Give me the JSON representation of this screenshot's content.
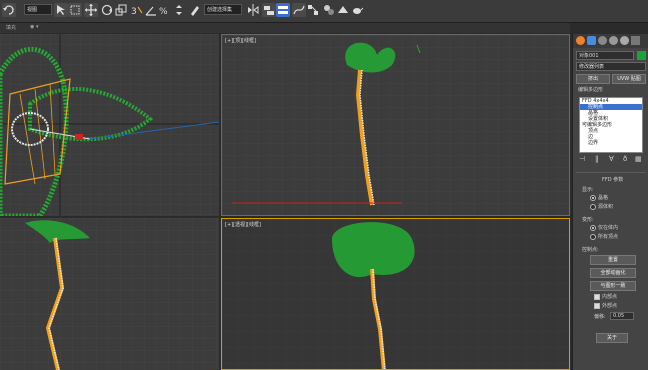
{
  "toolbar": {
    "select_filter": "视图",
    "selection_set": "创建选择集",
    "icons": [
      "undo-icon",
      "redo-icon",
      "select-icon",
      "select-region-icon",
      "move-icon",
      "rotate-icon",
      "scale-icon",
      "snap-icon",
      "angle-snap-icon",
      "percent-snap-icon",
      "spinner-snap-icon",
      "named-selection-icon",
      "mirror-icon",
      "align-icon",
      "layer-icon",
      "curve-editor-icon",
      "schematic-icon",
      "material-editor-icon",
      "render-setup-icon",
      "render-frame-icon",
      "render-icon",
      "teapot-icon"
    ]
  },
  "subbar": {
    "label": "填充"
  },
  "viewports": [
    {
      "id": "top-left",
      "label": ""
    },
    {
      "id": "top-right",
      "label": "[+][顶][线框]"
    },
    {
      "id": "bottom-left",
      "label": ""
    },
    {
      "id": "bottom-right",
      "label": "[+][透视][线框]"
    }
  ],
  "panel": {
    "object_name": "对象001",
    "modifier_list": "修改器列表",
    "buttons_row": [
      "挤出",
      "UVW 贴图"
    ],
    "edit_poly": "编辑多边形",
    "stack": [
      {
        "label": "FFD 4x4x4",
        "selected": false
      },
      {
        "label": "控制点",
        "selected": true
      },
      {
        "label": "晶格",
        "selected": false
      },
      {
        "label": "设置体积",
        "selected": false
      },
      {
        "label": "可编辑多边形",
        "selected": false
      },
      {
        "label": "顶点",
        "selected": false
      },
      {
        "label": "边",
        "selected": false
      },
      {
        "label": "边界",
        "selected": false
      }
    ],
    "ffd_title": "FFD 参数",
    "display_label": "显示:",
    "display_options": [
      {
        "label": "晶格",
        "on": true
      },
      {
        "label": "源体积",
        "on": false
      }
    ],
    "deform_label": "变形:",
    "deform_options": [
      {
        "label": "仅在体内",
        "on": true
      },
      {
        "label": "所有顶点",
        "on": false
      }
    ],
    "control_label": "控制点:",
    "reset_btn": "重置",
    "animate_all_btn": "全部动画化",
    "conform_btn": "与图形一致",
    "check_inside": {
      "label": "内部点",
      "on": true
    },
    "check_outside": {
      "label": "外部点",
      "on": true
    },
    "offset_label": "偏移:",
    "offset_value": "0.05",
    "about_btn": "关于"
  },
  "colors": {
    "accent": "#f0a020",
    "foliage": "#22aa33",
    "selection": "#3b6fd0"
  }
}
